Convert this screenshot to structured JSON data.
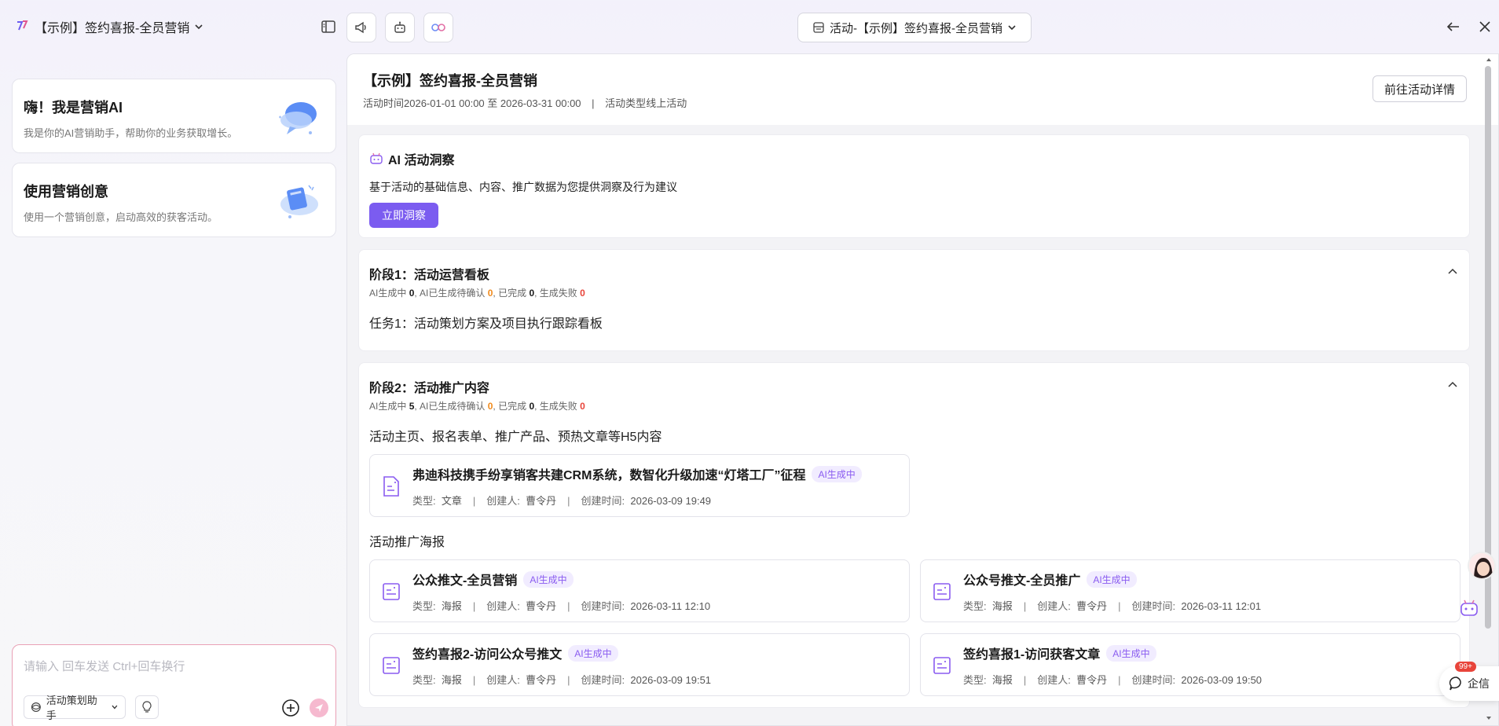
{
  "topbar": {
    "app_title": "【示例】签约喜报-全员营销",
    "activity_select": "活动-【示例】签约喜报-全员营销"
  },
  "left": {
    "cards": [
      {
        "title": "嗨！我是营销AI",
        "desc": "我是你的AI营销助手，帮助你的业务获取增长。"
      },
      {
        "title": "使用营销创意",
        "desc": "使用一个营销创意，启动高效的获客活动。"
      }
    ],
    "input": {
      "placeholder": "请输入 回车发送 Ctrl+回车换行",
      "assistant": "活动策划助手"
    }
  },
  "main": {
    "title": "【示例】签约喜报-全员营销",
    "meta": {
      "time_label": "活动时间",
      "time_value": "2026-01-01 00:00 至 2026-03-31 00:00",
      "divider": "|",
      "type_label": "活动类型",
      "type_value": "线上活动"
    },
    "go_detail": "前往活动详情",
    "insight": {
      "title": "AI 活动洞察",
      "desc": "基于活动的基础信息、内容、推广数据为您提供洞察及行为建议",
      "button": "立即洞察"
    },
    "stages": [
      {
        "title": "阶段1：活动运营看板",
        "stats": {
          "gen_label": "AI生成中",
          "gen": "0",
          "pending_label": ", AI已生成待确认",
          "pending": "0",
          "done_label": ", 已完成",
          "done": "0",
          "fail_label": ", 生成失败",
          "fail": "0"
        },
        "task": "任务1：活动策划方案及项目执行跟踪看板"
      },
      {
        "title": "阶段2：活动推广内容",
        "stats": {
          "gen_label": "AI生成中",
          "gen": "5",
          "pending_label": ", AI已生成待确认",
          "pending": "0",
          "done_label": ", 已完成",
          "done": "0",
          "fail_label": ", 生成失败",
          "fail": "0"
        },
        "section1": "活动主页、报名表单、推广产品、预热文章等H5内容",
        "section2": "活动推广海报"
      }
    ],
    "meta_labels": {
      "type": "类型:",
      "creator": "创建人:",
      "created": "创建时间:",
      "sep": "|"
    },
    "items": [
      {
        "title": "弗迪科技携手纷享销客共建CRM系统，数智化升级加速“灯塔工厂”征程",
        "badge": "AI生成中",
        "type": "文章",
        "creator": "曹令丹",
        "time": "2026-03-09 19:49"
      },
      {
        "title": "公众推文-全员营销",
        "badge": "AI生成中",
        "type": "海报",
        "creator": "曹令丹",
        "time": "2026-03-11 12:10"
      },
      {
        "title": "公众号推文-全员推广",
        "badge": "AI生成中",
        "type": "海报",
        "creator": "曹令丹",
        "time": "2026-03-11 12:01"
      },
      {
        "title": "签约喜报2-访问公众号推文",
        "badge": "AI生成中",
        "type": "海报",
        "creator": "曹令丹",
        "time": "2026-03-09 19:51"
      },
      {
        "title": "签约喜报1-访问获客文章",
        "badge": "AI生成中",
        "type": "海报",
        "creator": "曹令丹",
        "time": "2026-03-09 19:50"
      }
    ]
  },
  "float": {
    "qixin_badge": "99+",
    "qixin_label": "企信"
  },
  "colors": {
    "accent": "#7b5cf0",
    "badge_text": "#8a5cf0",
    "warn": "#f08a1c",
    "error": "#e8443a"
  }
}
